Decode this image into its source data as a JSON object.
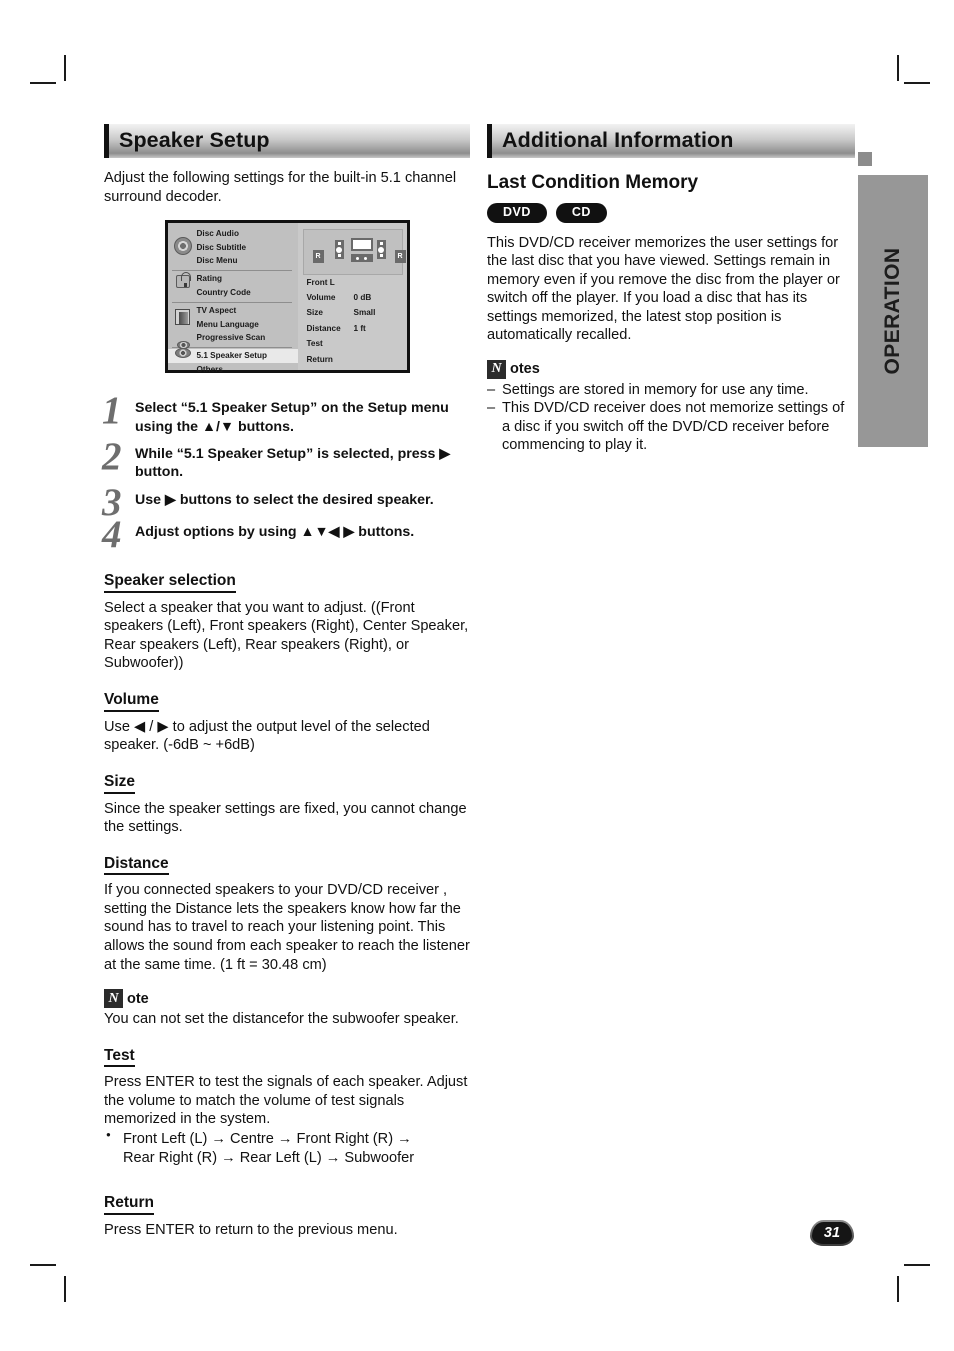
{
  "page": {
    "number": "31",
    "side_tab_label": "OPERATION"
  },
  "left_column": {
    "section_title": "Speaker Setup",
    "intro": "Adjust the following settings for the built-in 5.1 channel surround decoder.",
    "osd": {
      "menu_items": [
        "Disc Audio",
        "Disc Subtitle",
        "Disc Menu",
        "Rating",
        "Country Code",
        "TV Aspect",
        "Menu Language",
        "Progressive Scan",
        "5.1 Speaker Setup",
        "Others"
      ],
      "selected_item": "5.1 Speaker Setup",
      "panel": {
        "speaker_label": "Front L",
        "rows": [
          {
            "label": "Volume",
            "value": "0 dB"
          },
          {
            "label": "Size",
            "value": "Small"
          },
          {
            "label": "Distance",
            "value": "1 ft"
          },
          {
            "label": "Test",
            "value": ""
          },
          {
            "label": "Return",
            "value": ""
          }
        ],
        "diagram_rear_left_label": "R",
        "diagram_rear_right_label": "R"
      }
    },
    "steps": [
      {
        "num": "1",
        "text": "Select “5.1 Speaker Setup” on the Setup menu using the ▲/▼ buttons."
      },
      {
        "num": "2",
        "text": "While “5.1 Speaker Setup” is selected, press ▶ button."
      },
      {
        "num": "3",
        "text": "Use ▶ buttons to select the desired speaker."
      },
      {
        "num": "4",
        "text": "Adjust options by using ▲▼◀ ▶ buttons."
      }
    ],
    "speaker_selection": {
      "heading": "Speaker selection",
      "body": "Select a speaker that you want to adjust. ((Front speakers (Left), Front speakers (Right), Center Speaker, Rear speakers (Left), Rear  speakers (Right), or Subwoofer))"
    },
    "volume": {
      "heading": "Volume",
      "body": "Use ◀ / ▶ to adjust the output level of the selected speaker. (-6dB ~ +6dB)"
    },
    "size": {
      "heading": "Size",
      "body": "Since the speaker settings are fixed, you cannot change the settings."
    },
    "distance": {
      "heading": "Distance",
      "body": "If you connected speakers to your DVD/CD receiver , setting the Distance lets the speakers know how far the sound has to travel to reach your listening point. This allows the sound from each speaker to reach the listener at the same time. (1 ft = 30.48 cm)"
    },
    "distance_note": {
      "glyph": "N",
      "word": "ote",
      "body": "You can not set the distancefor the subwoofer speaker."
    },
    "test": {
      "heading": "Test",
      "body": "Press ENTER to test the signals of each speaker. Adjust the volume to match the volume of test signals memorized in the system.",
      "sequence_line1": "Front Left (L) → Centre → Front Right (R) →",
      "sequence_line2": "Rear Right (R) → Rear Left (L)  → Subwoofer"
    },
    "return": {
      "heading": "Return",
      "body": "Press ENTER to return to the previous menu."
    }
  },
  "right_column": {
    "section_title": "Additional Information",
    "subsection_title": "Last Condition Memory",
    "badges": [
      "DVD",
      "CD"
    ],
    "body": "This DVD/CD receiver  memorizes the user settings for the last disc that you have viewed. Settings remain in memory even if you remove the disc from the player or switch off the player. If you load a disc that has its settings memorized, the latest stop position is automatically recalled.",
    "notes": {
      "glyph": "N",
      "word": "otes",
      "items": [
        "Settings are stored in memory for use any time.",
        "This DVD/CD receiver does not memorize settings of a disc if you switch off the DVD/CD receiver  before commencing to play it."
      ]
    }
  },
  "colors": {
    "header_bar_dark": "#8e8e8e",
    "side_tab": "#979797",
    "osd_background": "#c0c0c0",
    "badge": "#111111"
  }
}
